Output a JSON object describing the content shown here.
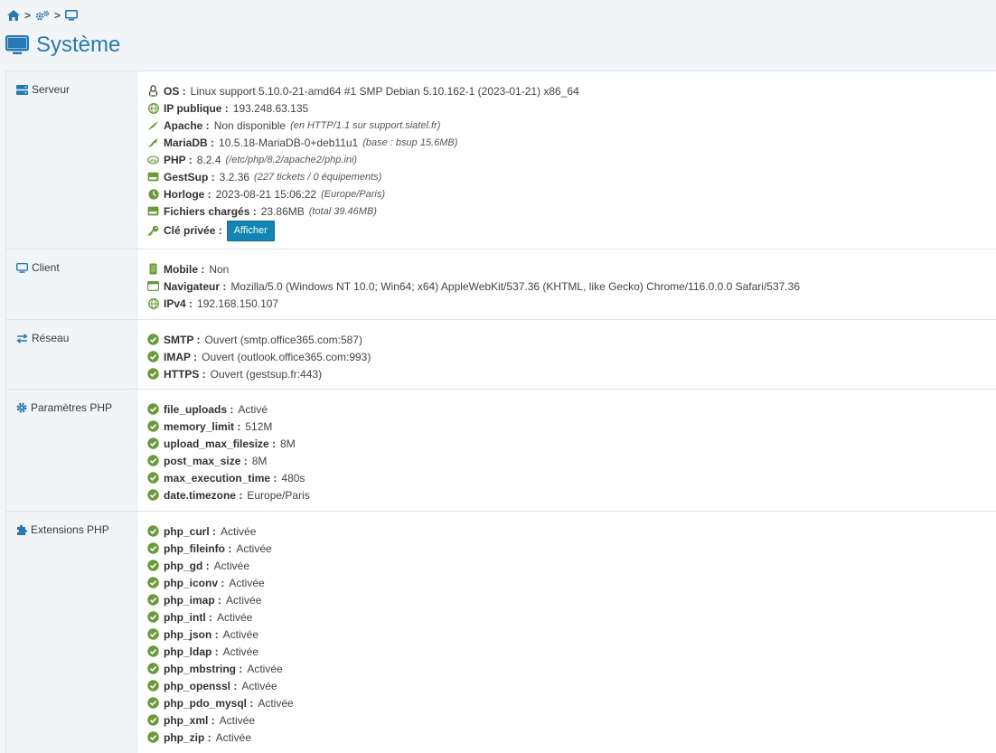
{
  "breadcrumb": {
    "sep1": ">",
    "sep2": ">"
  },
  "title": "Système",
  "sections": {
    "serveur": {
      "label": "Serveur",
      "lines": [
        {
          "label": "OS :",
          "value": "Linux support 5.10.0-21-amd64 #1 SMP Debian 5.10.162-1 (2023-01-21) x86_64",
          "note": ""
        },
        {
          "label": "IP publique :",
          "value": "193.248.63.135",
          "note": ""
        },
        {
          "label": "Apache :",
          "value": "Non disponible",
          "note": "(en HTTP/1.1 sur support.siatel.fr)"
        },
        {
          "label": "MariaDB :",
          "value": "10.5.18-MariaDB-0+deb11u1",
          "note": "(base : bsup 15.6MB)"
        },
        {
          "label": "PHP :",
          "value": "8.2.4",
          "note": "(/etc/php/8.2/apache2/php.ini)"
        },
        {
          "label": "GestSup :",
          "value": "3.2.36",
          "note": "(227 tickets / 0 équipements)"
        },
        {
          "label": "Horloge :",
          "value": "2023-08-21 15:06:22",
          "note": "(Europe/Paris)"
        },
        {
          "label": "Fichiers chargés :",
          "value": "23.86MB",
          "note": "(total 39.46MB)"
        },
        {
          "label": "Clé privée :",
          "button": "Afficher"
        }
      ]
    },
    "client": {
      "label": "Client",
      "lines": [
        {
          "label": "Mobile :",
          "value": "Non"
        },
        {
          "label": "Navigateur :",
          "value": "Mozilla/5.0 (Windows NT 10.0; Win64; x64) AppleWebKit/537.36 (KHTML, like Gecko) Chrome/116.0.0.0 Safari/537.36"
        },
        {
          "label": "IPv4 :",
          "value": "192.168.150.107"
        }
      ]
    },
    "reseau": {
      "label": "Réseau",
      "lines": [
        {
          "label": "SMTP :",
          "value": "Ouvert (smtp.office365.com:587)"
        },
        {
          "label": "IMAP :",
          "value": "Ouvert (outlook.office365.com:993)"
        },
        {
          "label": "HTTPS :",
          "value": "Ouvert (gestsup.fr:443)"
        }
      ]
    },
    "params": {
      "label": "Paramètres PHP",
      "lines": [
        {
          "label": "file_uploads :",
          "value": "Activé"
        },
        {
          "label": "memory_limit :",
          "value": "512M"
        },
        {
          "label": "upload_max_filesize :",
          "value": "8M"
        },
        {
          "label": "post_max_size :",
          "value": "8M"
        },
        {
          "label": "max_execution_time :",
          "value": "480s"
        },
        {
          "label": "date.timezone :",
          "value": "Europe/Paris"
        }
      ]
    },
    "extensions": {
      "label": "Extensions PHP",
      "lines": [
        {
          "label": "php_curl :",
          "value": "Activée"
        },
        {
          "label": "php_fileinfo :",
          "value": "Activée"
        },
        {
          "label": "php_gd :",
          "value": "Activée"
        },
        {
          "label": "php_iconv :",
          "value": "Activée"
        },
        {
          "label": "php_imap :",
          "value": "Activée"
        },
        {
          "label": "php_intl :",
          "value": "Activée"
        },
        {
          "label": "php_json :",
          "value": "Activée"
        },
        {
          "label": "php_ldap :",
          "value": "Activée"
        },
        {
          "label": "php_mbstring :",
          "value": "Activée"
        },
        {
          "label": "php_openssl :",
          "value": "Activée"
        },
        {
          "label": "php_pdo_mysql :",
          "value": "Activée"
        },
        {
          "label": "php_xml :",
          "value": "Activée"
        },
        {
          "label": "php_zip :",
          "value": "Activée"
        }
      ]
    }
  },
  "colors": {
    "accent": "#2679b5",
    "green": "#6a9a3a",
    "button": "#1385b3",
    "bg": "#f2f5f8"
  }
}
